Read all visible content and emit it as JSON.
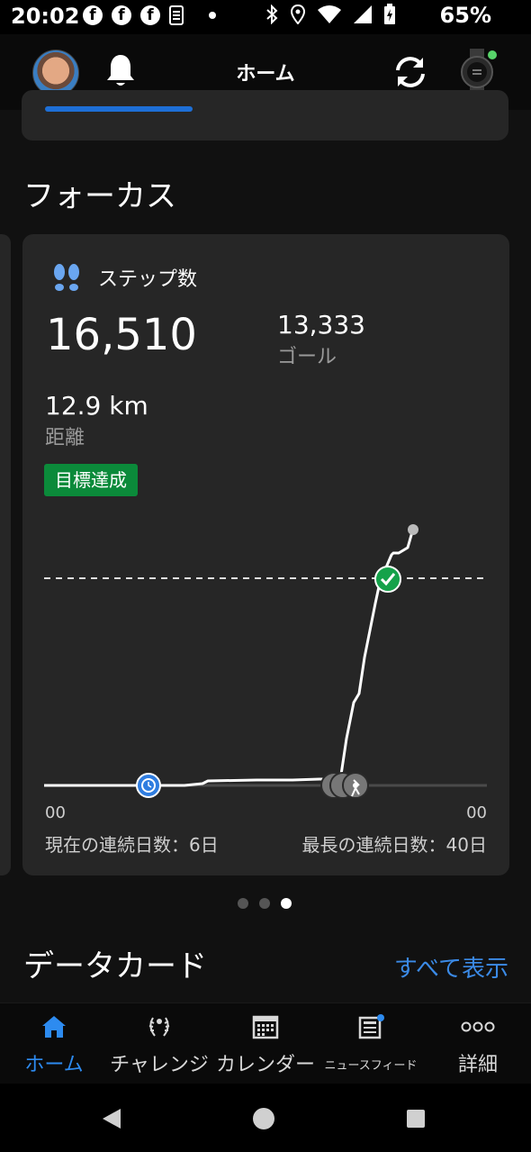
{
  "status_bar": {
    "time": "20:02",
    "battery": "65%",
    "icons": [
      "facebook-icon",
      "facebook-icon",
      "facebook-icon",
      "sim-icon",
      "dot-icon",
      "bluetooth-icon",
      "location-icon",
      "wifi-icon",
      "signal-icon",
      "battery-charging-icon"
    ]
  },
  "header": {
    "title": "ホーム",
    "icons": [
      "avatar",
      "bell-icon",
      "sync-icon",
      "watch-icon"
    ]
  },
  "focus": {
    "section_title": "フォーカス",
    "card": {
      "label": "ステップ数",
      "steps": "16,510",
      "goal_value": "13,333",
      "goal_label": "ゴール",
      "distance_value": "12.9 km",
      "distance_label": "距離",
      "badge": "目標達成",
      "x_start": "00",
      "x_end": "00",
      "current_streak": "現在の連続日数：6日",
      "longest_streak": "最長の連続日数：40日"
    },
    "pager": {
      "pages": 3,
      "active": 3
    }
  },
  "data_cards": {
    "section_title": "データカード",
    "see_all": "すべて表示"
  },
  "bottom_nav": {
    "items": [
      {
        "label": "ホーム",
        "icon": "home-icon",
        "active": true
      },
      {
        "label": "チャレンジ",
        "icon": "laurel-icon",
        "active": false
      },
      {
        "label": "カレンダー",
        "icon": "calendar-icon",
        "active": false
      },
      {
        "label": "ニュースフィード",
        "icon": "newsfeed-icon",
        "active": false
      },
      {
        "label": "詳細",
        "icon": "more-icon",
        "active": false
      }
    ]
  },
  "colors": {
    "accent": "#2d8bf0",
    "goal_badge": "#0b8a3a",
    "card_bg": "#262626"
  }
}
